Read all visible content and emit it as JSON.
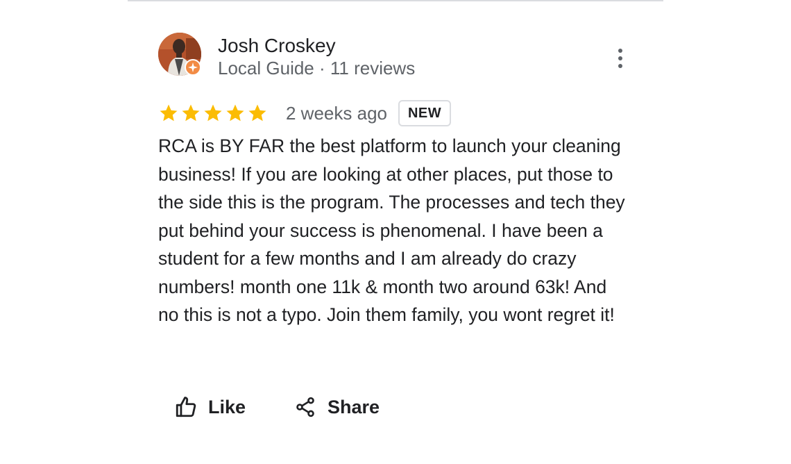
{
  "review": {
    "reviewer": {
      "name": "Josh Croskey",
      "meta": "Local Guide · 11 reviews",
      "badge_color": "#f28b45"
    },
    "rating": {
      "stars": 5,
      "max": 5,
      "star_color": "#fbbc04"
    },
    "date": "2 weeks ago",
    "badge": "NEW",
    "text": "RCA is BY FAR the best platform to launch your cleaning business! If you are looking at other places, put those to the side this is the program. The processes and tech they put behind your success is phenomenal. I have been a student for a few months and I am already do crazy numbers! month one 11k & month two around 63k! And no this is not a typo. Join them family, you wont regret it!",
    "actions": {
      "like_label": "Like",
      "share_label": "Share"
    },
    "icons": {
      "more": "more-vert-icon",
      "like": "thumb-up-icon",
      "share": "share-icon",
      "local_guide": "local-guide-star-icon"
    }
  }
}
